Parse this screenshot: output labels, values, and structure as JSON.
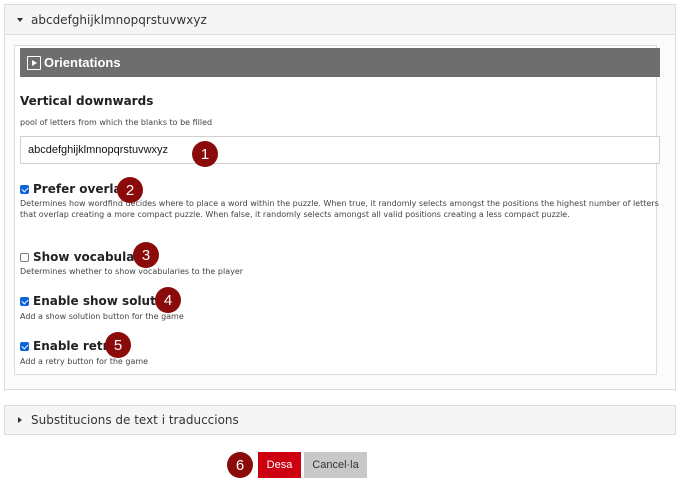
{
  "panel": {
    "title": "abcdefghijklmnopqrstuvwxyz"
  },
  "group": {
    "title": "Orientations"
  },
  "fields": {
    "vertical": {
      "label": "Vertical downwards",
      "description": "pool of letters from which the blanks to be filled",
      "value": "abcdefghijklmnopqrstuvwxyz"
    },
    "prefer_overlap": {
      "label": "Prefer overlap",
      "checked": true,
      "description": "Determines how wordfind decides where to place a word within the puzzle. When true, it randomly selects amongst the positions the highest number of letters that overlap creating a more compact puzzle. When false, it randomly selects amongst all valid positions creating a less compact puzzle."
    },
    "show_vocabulary": {
      "label": "Show vocabulary",
      "checked": false,
      "description": "Determines whether to show vocabularies to the player"
    },
    "enable_show_solution": {
      "label": "Enable show solution",
      "checked": true,
      "description": "Add a show solution button for the game"
    },
    "enable_retry": {
      "label": "Enable retry",
      "checked": true,
      "description": "Add a retry button for the game"
    }
  },
  "panel2": {
    "title": "Substitucions de text i traduccions"
  },
  "buttons": {
    "save": "Desa",
    "cancel": "Cancel·la"
  },
  "badges": [
    "1",
    "2",
    "3",
    "4",
    "5",
    "6"
  ],
  "colors": {
    "badge": "#8b0b0b",
    "save": "#cc0011",
    "checkbox": "#0a64d8"
  }
}
